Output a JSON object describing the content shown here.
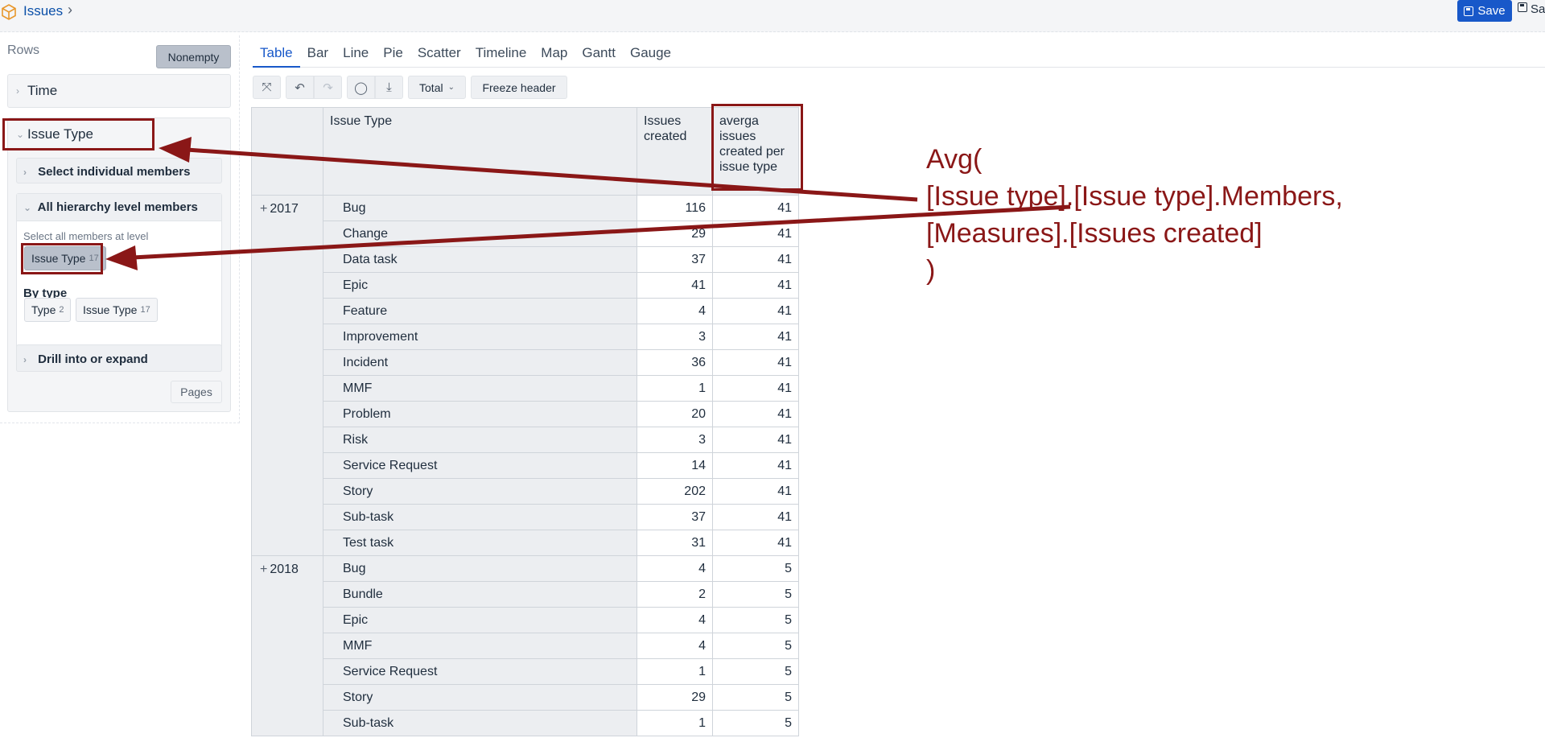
{
  "header": {
    "title": "Issues",
    "save_label": "Save",
    "save_as_label": "Sa"
  },
  "left_panel": {
    "rows_label": "Rows",
    "nonempty_label": "Nonempty",
    "time_label": "Time",
    "issue_type_label": "Issue Type",
    "select_individual_label": "Select individual members",
    "all_hierarchy_label": "All hierarchy level members",
    "select_all_label": "Select all members at level",
    "level_chip": {
      "label": "Issue Type",
      "count": "17"
    },
    "by_type_label": "By type",
    "type_chips": [
      {
        "label": "Type",
        "count": "2"
      },
      {
        "label": "Issue Type",
        "count": "17"
      }
    ],
    "drill_label": "Drill into or expand",
    "pages_label": "Pages"
  },
  "tabs": [
    "Table",
    "Bar",
    "Line",
    "Pie",
    "Scatter",
    "Timeline",
    "Map",
    "Gantt",
    "Gauge"
  ],
  "toolbar": {
    "total_label": "Total",
    "freeze_label": "Freeze header"
  },
  "table": {
    "headers": [
      "Issue Type",
      "Issues created",
      "averga issues created per issue type"
    ],
    "groups": [
      {
        "year": "2017",
        "rows": [
          [
            "Bug",
            "116",
            "41"
          ],
          [
            "Change",
            "29",
            "41"
          ],
          [
            "Data task",
            "37",
            "41"
          ],
          [
            "Epic",
            "41",
            "41"
          ],
          [
            "Feature",
            "4",
            "41"
          ],
          [
            "Improvement",
            "3",
            "41"
          ],
          [
            "Incident",
            "36",
            "41"
          ],
          [
            "MMF",
            "1",
            "41"
          ],
          [
            "Problem",
            "20",
            "41"
          ],
          [
            "Risk",
            "3",
            "41"
          ],
          [
            "Service Request",
            "14",
            "41"
          ],
          [
            "Story",
            "202",
            "41"
          ],
          [
            "Sub-task",
            "37",
            "41"
          ],
          [
            "Test task",
            "31",
            "41"
          ]
        ]
      },
      {
        "year": "2018",
        "rows": [
          [
            "Bug",
            "4",
            "5"
          ],
          [
            "Bundle",
            "2",
            "5"
          ],
          [
            "Epic",
            "4",
            "5"
          ],
          [
            "MMF",
            "4",
            "5"
          ],
          [
            "Service Request",
            "1",
            "5"
          ],
          [
            "Story",
            "29",
            "5"
          ],
          [
            "Sub-task",
            "1",
            "5"
          ]
        ]
      }
    ]
  },
  "annotation": {
    "formula_lines": [
      "Avg(",
      "[Issue type].[Issue type].Members,",
      "[Measures].[Issues created]",
      ")"
    ],
    "color": "#8a1717"
  },
  "colors": {
    "accent": "#1858c9",
    "annotation": "#8a1717"
  }
}
